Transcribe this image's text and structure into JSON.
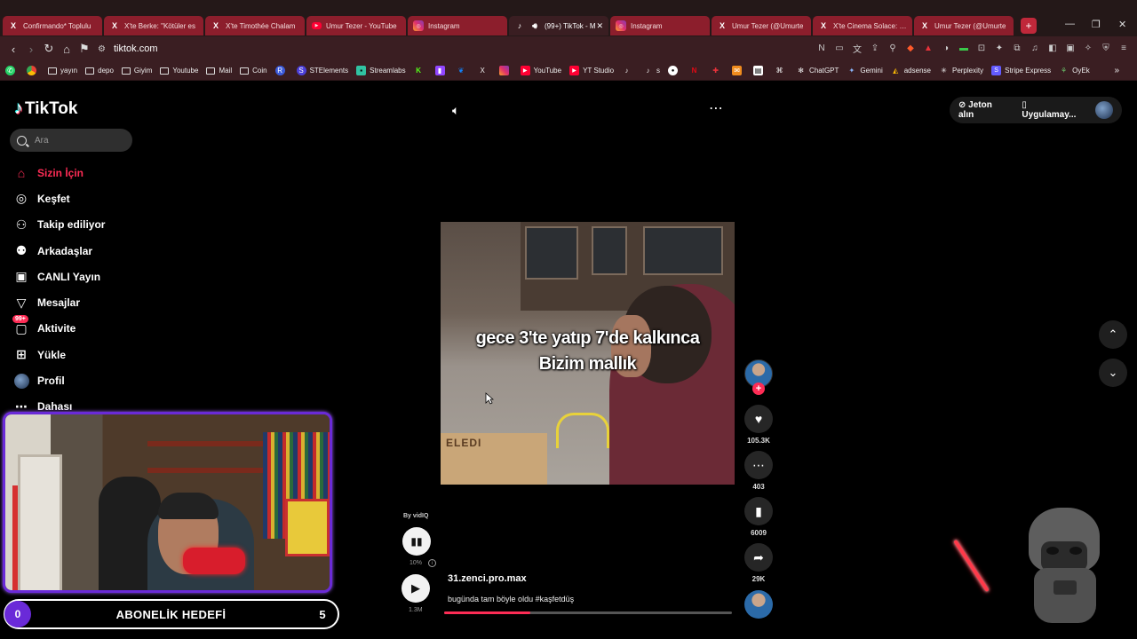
{
  "browser": {
    "tabs": [
      {
        "icon": "x",
        "label": "Confirmando* Toplulu",
        "active": false
      },
      {
        "icon": "x",
        "label": "X'te Berke: \"Kötüler es",
        "active": false
      },
      {
        "icon": "x",
        "label": "X'te Timothée Chalam",
        "active": false
      },
      {
        "icon": "youtube",
        "label": "Umur Tezer - YouTube",
        "active": false
      },
      {
        "icon": "instagram",
        "label": "Instagram",
        "active": false
      },
      {
        "icon": "tiktok",
        "label": "(99+) TikTok - M",
        "active": true
      },
      {
        "icon": "instagram",
        "label": "Instagram",
        "active": false
      },
      {
        "icon": "x",
        "label": "Umur Tezer (@Umurte",
        "active": false
      },
      {
        "icon": "x",
        "label": "X'te Cinema Solace: \"N",
        "active": false
      },
      {
        "icon": "x",
        "label": "Umur Tezer (@Umurte",
        "active": false
      }
    ],
    "url": "tiktok.com",
    "bookmarks": [
      {
        "icon": "whatsapp",
        "label": ""
      },
      {
        "icon": "chrome",
        "label": ""
      },
      {
        "icon": "folder",
        "label": "yayın"
      },
      {
        "icon": "folder",
        "label": "depo"
      },
      {
        "icon": "folder",
        "label": "Giyim"
      },
      {
        "icon": "folder",
        "label": "Youtube"
      },
      {
        "icon": "folder",
        "label": "Mail"
      },
      {
        "icon": "folder",
        "label": "Coin"
      },
      {
        "icon": "r",
        "label": ""
      },
      {
        "icon": "streamelements",
        "label": "STElements"
      },
      {
        "icon": "streamlabs",
        "label": "Streamlabs"
      },
      {
        "icon": "kick",
        "label": ""
      },
      {
        "icon": "twitch",
        "label": ""
      },
      {
        "icon": "bluesky",
        "label": ""
      },
      {
        "icon": "x",
        "label": ""
      },
      {
        "icon": "instagram",
        "label": ""
      },
      {
        "icon": "youtube",
        "label": "YouTube"
      },
      {
        "icon": "youtube",
        "label": "YT Studio"
      },
      {
        "icon": "tiktok",
        "label": ""
      },
      {
        "icon": "tiktok",
        "label": "s"
      },
      {
        "icon": "circle",
        "label": ""
      },
      {
        "icon": "netflix",
        "label": ""
      },
      {
        "icon": "game",
        "label": ""
      },
      {
        "icon": "mail",
        "label": ""
      },
      {
        "icon": "letterboxd",
        "label": ""
      },
      {
        "icon": "capcut",
        "label": ""
      },
      {
        "icon": "openai",
        "label": "ChatGPT"
      },
      {
        "icon": "gemini",
        "label": "Gemini"
      },
      {
        "icon": "adsense",
        "label": "adsense"
      },
      {
        "icon": "perplexity",
        "label": "Perplexity"
      },
      {
        "icon": "stripe",
        "label": "Stripe Express"
      },
      {
        "icon": "oyek",
        "label": "OyEk"
      }
    ]
  },
  "tiktok": {
    "brand": "TikTok",
    "search_placeholder": "Ara",
    "nav": [
      {
        "icon": "home-icon",
        "label": "Sizin İçin",
        "active": true
      },
      {
        "icon": "compass-icon",
        "label": "Keşfet",
        "active": false
      },
      {
        "icon": "following-icon",
        "label": "Takip ediliyor",
        "active": false
      },
      {
        "icon": "friends-icon",
        "label": "Arkadaşlar",
        "active": false
      },
      {
        "icon": "live-icon",
        "label": "CANLI Yayın",
        "active": false
      },
      {
        "icon": "messages-icon",
        "label": "Mesajlar",
        "active": false
      },
      {
        "icon": "activity-icon",
        "label": "Aktivite",
        "active": false,
        "badge": "99+"
      },
      {
        "icon": "upload-icon",
        "label": "Yükle",
        "active": false
      },
      {
        "icon": "profile-icon",
        "label": "Profil",
        "active": false
      },
      {
        "icon": "more-icon",
        "label": "Dahası",
        "active": false
      }
    ],
    "top_right": {
      "coins_label": "Jeton alın",
      "app_label": "Uygulamay..."
    },
    "video": {
      "caption_line1": "gece 3'te yatıp 7'de kalkınca",
      "caption_line2": "Bizim mallık",
      "box_text": "ELEDI",
      "byline": "By vidIQ",
      "stat_pct": "10%",
      "views": "1.3M",
      "author": "31.zenci.pro.max",
      "description": "bugünda tam böyle oldu #kaşfetdüş",
      "progress": 0.3
    },
    "actions": {
      "likes": "105.3K",
      "comments": "403",
      "saves": "6009",
      "shares": "29K"
    }
  },
  "overlay": {
    "goal_start": "0",
    "goal_title": "ABONELİK HEDEFİ",
    "goal_end": "5"
  },
  "colors": {
    "accent": "#fe2c55",
    "tab_bg": "#8c1e2c",
    "chrome_bg": "#3a1e22",
    "cam_border": "#6a2ad8"
  }
}
